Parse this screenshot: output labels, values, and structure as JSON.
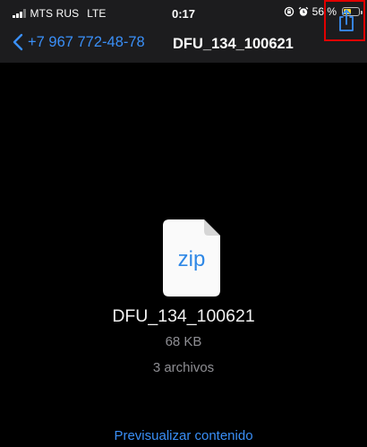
{
  "status_bar": {
    "carrier": "MTS RUS",
    "network": "LTE",
    "time": "0:17",
    "battery_percent": "56 %",
    "battery_level": 0.56,
    "signal_bars_active": 3,
    "icons": [
      "signal-icon",
      "rotation-lock-icon",
      "alarm-icon",
      "battery-icon"
    ]
  },
  "nav": {
    "back_label": "+7 967 772-48-78",
    "title": "DFU_134_100621",
    "accent_color": "#3a8ff7",
    "highlight_color": "#e10000"
  },
  "file": {
    "icon_label": "zip",
    "name": "DFU_134_100621",
    "size": "68 KB",
    "count": "3 archivos"
  },
  "footer": {
    "preview_label": "Previsualizar contenido"
  }
}
